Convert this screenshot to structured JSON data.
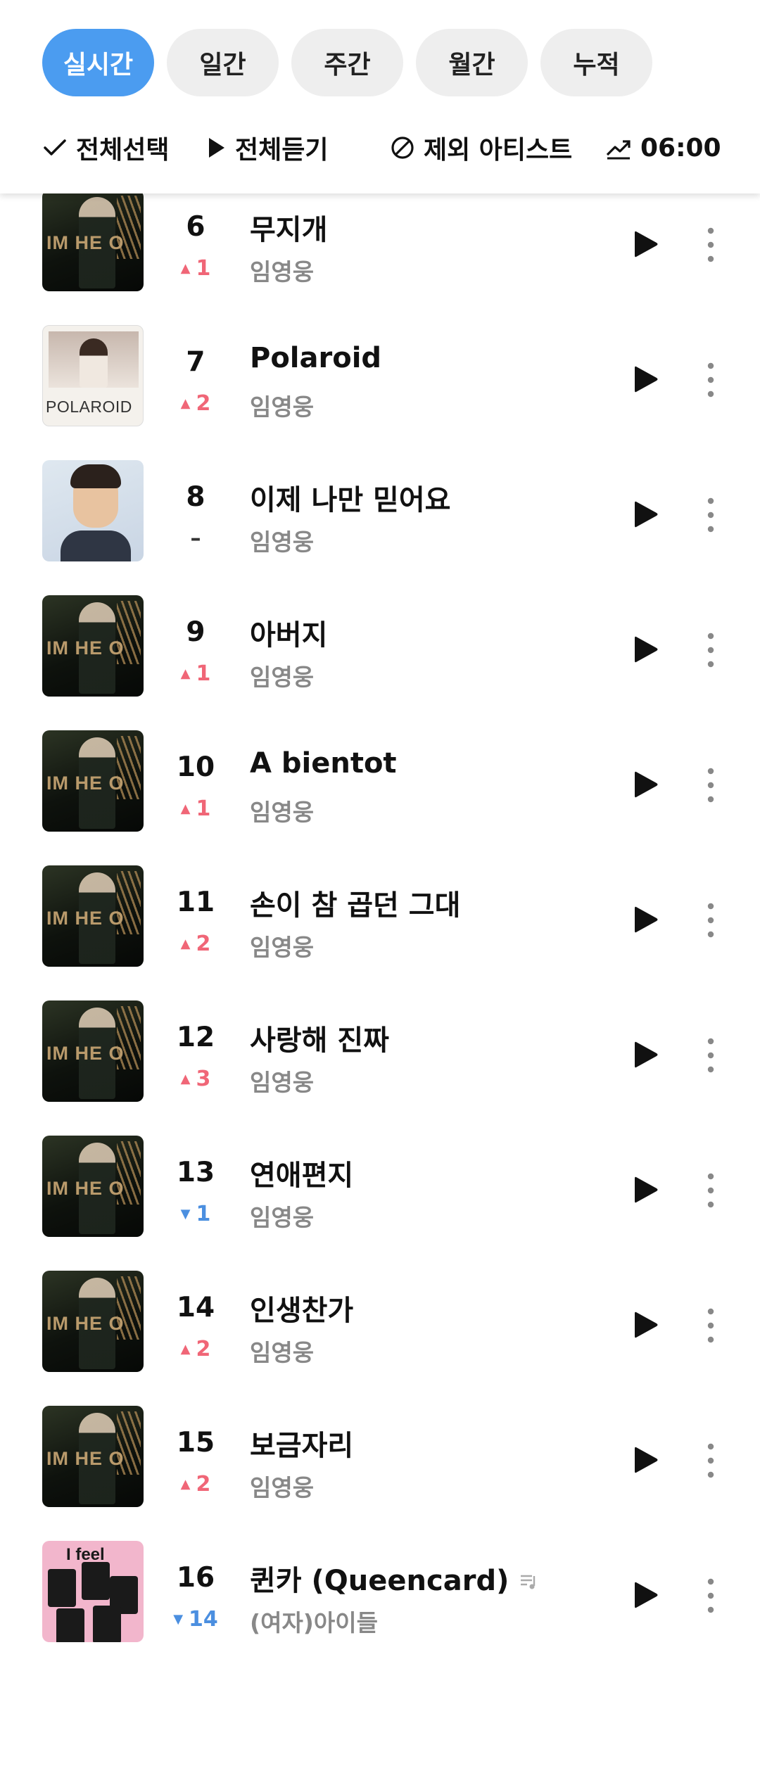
{
  "tabs": [
    {
      "label": "실시간",
      "active": true
    },
    {
      "label": "일간",
      "active": false
    },
    {
      "label": "주간",
      "active": false
    },
    {
      "label": "월간",
      "active": false
    },
    {
      "label": "누적",
      "active": false
    }
  ],
  "actions": {
    "select_all": "전체선택",
    "play_all": "전체듣기",
    "exclude_artist": "제외 아티스트",
    "time": "06:00"
  },
  "colors": {
    "accent": "#4b9cf0",
    "rank_up": "#f06677",
    "rank_down": "#4b8fe0"
  },
  "songs": [
    {
      "rank": "",
      "change_dir": "up",
      "change": "1",
      "title": "",
      "artist": "임영웅",
      "art": "polaroid"
    },
    {
      "rank": "6",
      "change_dir": "up",
      "change": "1",
      "title": "무지개",
      "artist": "임영웅",
      "art": "im-hero"
    },
    {
      "rank": "7",
      "change_dir": "up",
      "change": "2",
      "title": "Polaroid",
      "artist": "임영웅",
      "art": "polaroid"
    },
    {
      "rank": "8",
      "change_dir": "same",
      "change": "–",
      "title": "이제 나만 믿어요",
      "artist": "임영웅",
      "art": "portrait"
    },
    {
      "rank": "9",
      "change_dir": "up",
      "change": "1",
      "title": "아버지",
      "artist": "임영웅",
      "art": "im-hero"
    },
    {
      "rank": "10",
      "change_dir": "up",
      "change": "1",
      "title": "A bientot",
      "artist": "임영웅",
      "art": "im-hero"
    },
    {
      "rank": "11",
      "change_dir": "up",
      "change": "2",
      "title": "손이 참 곱던 그대",
      "artist": "임영웅",
      "art": "im-hero"
    },
    {
      "rank": "12",
      "change_dir": "up",
      "change": "3",
      "title": "사랑해 진짜",
      "artist": "임영웅",
      "art": "im-hero"
    },
    {
      "rank": "13",
      "change_dir": "down",
      "change": "1",
      "title": "연애편지",
      "artist": "임영웅",
      "art": "im-hero"
    },
    {
      "rank": "14",
      "change_dir": "up",
      "change": "2",
      "title": "인생찬가",
      "artist": "임영웅",
      "art": "im-hero"
    },
    {
      "rank": "15",
      "change_dir": "up",
      "change": "2",
      "title": "보금자리",
      "artist": "임영웅",
      "art": "im-hero"
    },
    {
      "rank": "16",
      "change_dir": "down",
      "change": "14",
      "title": "퀸카 (Queencard)",
      "artist": "(여자)아이들",
      "art": "queencard",
      "has_lyric_icon": true
    }
  ],
  "album_text": {
    "im_hero": "IM HE O",
    "polaroid": "POLAROID",
    "queencard": "I feel"
  },
  "icons": [
    "check-icon",
    "play-icon",
    "block-icon",
    "trend-icon",
    "more-vertical-icon",
    "lyrics-icon"
  ]
}
